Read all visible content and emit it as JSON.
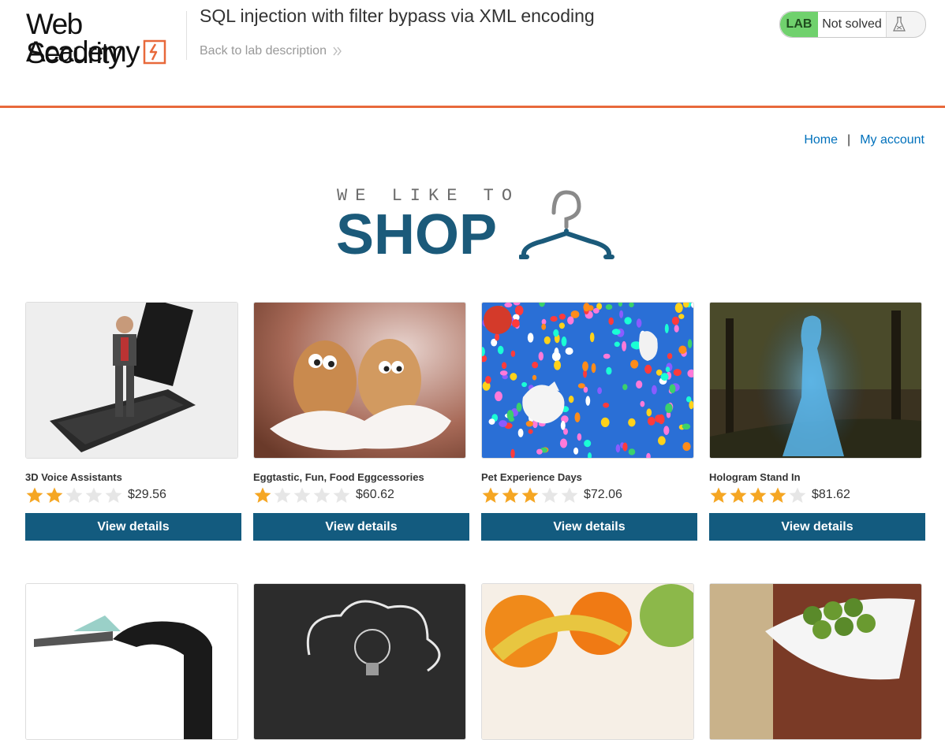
{
  "header": {
    "logo_line1": "Web Security",
    "logo_line2": "Academy",
    "lab_title": "SQL injection with filter bypass via XML encoding",
    "back_link": "Back to lab description",
    "status_tag": "LAB",
    "status_text": "Not solved",
    "accent_color": "#e8693b"
  },
  "nav": {
    "home": "Home",
    "separator": "|",
    "account": "My account"
  },
  "hero": {
    "line1": "WE LIKE TO",
    "line2": "SHOP"
  },
  "products": [
    {
      "name": "3D Voice Assistants",
      "rating": 2,
      "price": "$29.56",
      "button": "View details",
      "image": "figurine-on-phone"
    },
    {
      "name": "Eggtastic, Fun, Food Eggcessories",
      "rating": 1,
      "price": "$60.62",
      "button": "View details",
      "image": "eggs-with-eyes"
    },
    {
      "name": "Pet Experience Days",
      "rating": 3,
      "price": "$72.06",
      "button": "View details",
      "image": "dogs-with-balloons"
    },
    {
      "name": "Hologram Stand In",
      "rating": 4,
      "price": "$81.62",
      "button": "View details",
      "image": "hologram-woman"
    }
  ],
  "products_row2": [
    {
      "image": "headphones"
    },
    {
      "image": "lightbulb-chalk"
    },
    {
      "image": "fruit"
    },
    {
      "image": "sprouts-bowl"
    }
  ]
}
